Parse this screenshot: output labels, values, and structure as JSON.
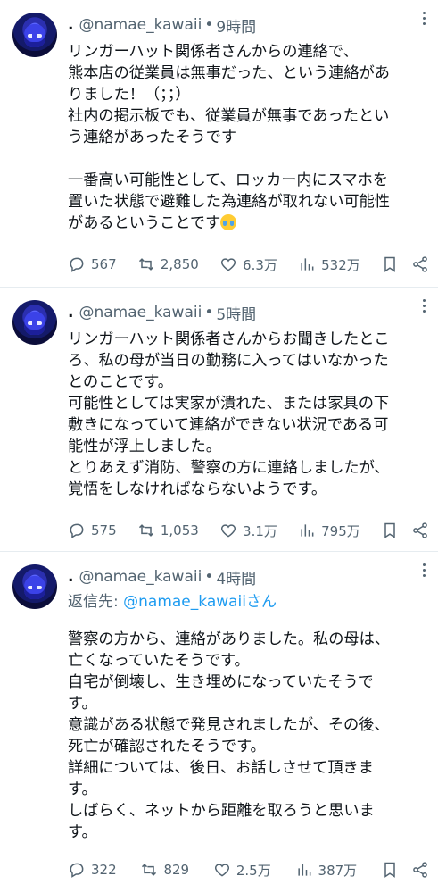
{
  "tweets": [
    {
      "dot": ".",
      "handle": "@namae_kawaii",
      "sep": "•",
      "time": "9時間",
      "text": "リンガーハット関係者さんからの連絡で、\n熊本店の従業員は無事だった、という連絡があ\nりました！（；；）\n社内の掲示板でも、従業員が無事であったとい\nう連絡があったそうです\n\n一番高い可能性として、ロッカー内にスマホを\n置いた状態で避難した為連絡が取れない可能性\nがあるということです",
      "emoji": "loudly-crying-face",
      "replies": "567",
      "retweets": "2,850",
      "likes": "6.3万",
      "views": "532万"
    },
    {
      "dot": ".",
      "handle": "@namae_kawaii",
      "sep": "•",
      "time": "5時間",
      "text": "リンガーハット関係者さんからお聞きしたとこ\nろ、私の母が当日の勤務に入ってはいなかった\nとのことです。\n可能性としては実家が潰れた、または家具の下\n敷きになっていて連絡ができない状況である可\n能性が浮上しました。\nとりあえず消防、警察の方に連絡しましたが、\n覚悟をしなければならないようです。",
      "replies": "575",
      "retweets": "1,053",
      "likes": "3.1万",
      "views": "795万"
    },
    {
      "dot": ".",
      "handle": "@namae_kawaii",
      "sep": "•",
      "time": "4時間",
      "reply_prefix": "返信先: ",
      "reply_mention": "@namae_kawaii",
      "reply_suffix": "さん",
      "text": "警察の方から、連絡がありました。私の母は、\n亡くなっていたそうです。\n自宅が倒壊し、生き埋めになっていたそうで\nす。\n意識がある状態で発見されましたが、その後、\n死亡が確認されたそうです。\n詳細については、後日、お話しさせて頂きま\nす。\nしばらく、ネットから距離を取ろうと思いま\nす。",
      "replies": "322",
      "retweets": "829",
      "likes": "2.5万",
      "views": "387万"
    }
  ],
  "colors": {
    "text": "#0f1419",
    "muted": "#536471",
    "link": "#1d9bf0",
    "border": "#e6ecf0"
  },
  "icons": [
    "reply-icon",
    "retweet-icon",
    "like-icon",
    "views-icon",
    "bookmark-icon",
    "share-icon",
    "more-icon"
  ]
}
